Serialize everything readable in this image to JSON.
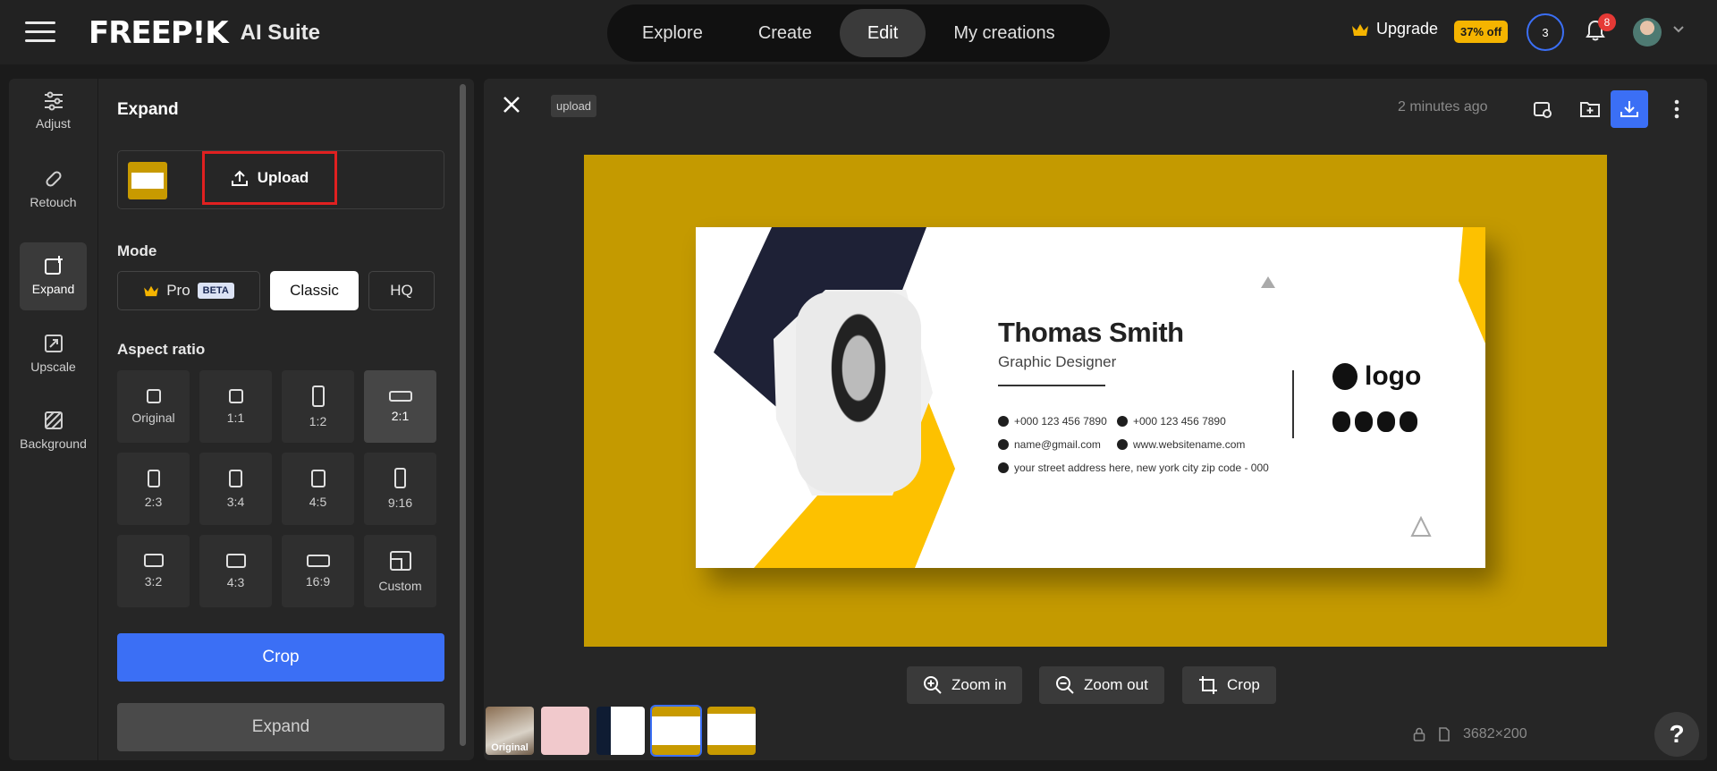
{
  "header": {
    "brand_logo": "FREEP!K",
    "brand_suite": "AI Suite",
    "tabs": [
      {
        "label": "Explore"
      },
      {
        "label": "Create"
      },
      {
        "label": "Edit",
        "active": true
      },
      {
        "label": "My creations"
      }
    ],
    "upgrade_label": "Upgrade",
    "discount_badge": "37% off",
    "credits_count": "3",
    "notification_count": "8"
  },
  "rail": {
    "items": [
      {
        "label": "Adjust",
        "icon": "sliders-icon"
      },
      {
        "label": "Retouch",
        "icon": "bandage-icon"
      },
      {
        "label": "Expand",
        "icon": "expand-icon",
        "active": true
      },
      {
        "label": "Upscale",
        "icon": "upscale-icon"
      },
      {
        "label": "Background",
        "icon": "background-icon"
      }
    ]
  },
  "panel": {
    "title": "Expand",
    "upload_label": "Upload",
    "mode_label": "Mode",
    "modes": [
      {
        "label": "Pro",
        "badge": "BETA"
      },
      {
        "label": "Classic",
        "selected": true
      },
      {
        "label": "HQ"
      }
    ],
    "aspect_label": "Aspect ratio",
    "aspect_ratios": [
      {
        "label": "Original"
      },
      {
        "label": "1:1"
      },
      {
        "label": "1:2"
      },
      {
        "label": "2:1",
        "selected": true
      },
      {
        "label": "2:3"
      },
      {
        "label": "3:4"
      },
      {
        "label": "4:5"
      },
      {
        "label": "9:16"
      },
      {
        "label": "3:2"
      },
      {
        "label": "4:3"
      },
      {
        "label": "16:9"
      },
      {
        "label": "Custom"
      }
    ],
    "crop_label": "Crop",
    "expand_label": "Expand"
  },
  "canvas": {
    "tag": "upload",
    "time_ago": "2 minutes ago",
    "card": {
      "name": "Thomas Smith",
      "role": "Graphic Designer",
      "phone1": "+000 123 456 7890",
      "phone2": "+000 123 456 7890",
      "email": "name@gmail.com",
      "website": "www.websitename.com",
      "address": "your street address here, new york city zip code - 000",
      "logo_text": "logo"
    },
    "zoom_in_label": "Zoom in",
    "zoom_out_label": "Zoom out",
    "crop_label": "Crop",
    "thumb_original_label": "Original",
    "dimensions": "3682×200",
    "help_label": "?"
  },
  "colors": {
    "accent": "#3b6ff5",
    "stage_bg": "#c49a00",
    "highlight_border": "#e02020",
    "discount": "#f5b400"
  }
}
